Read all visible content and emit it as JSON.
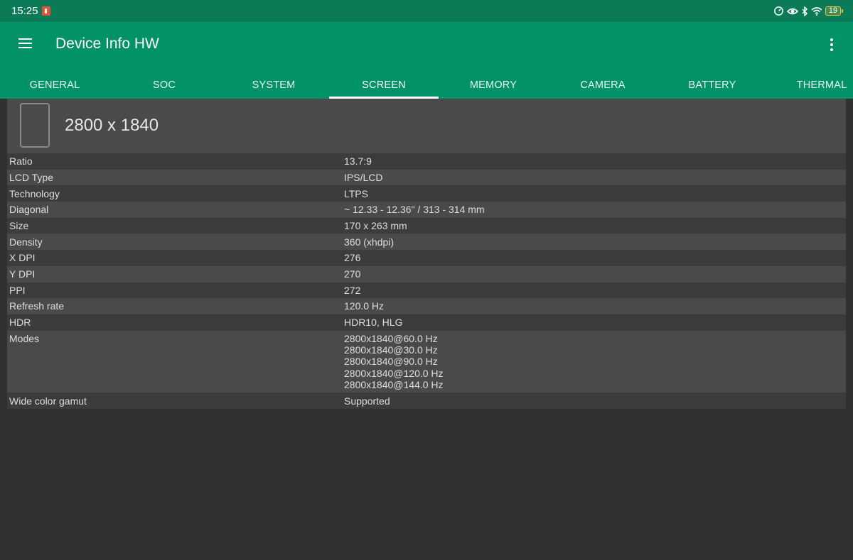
{
  "status_bar": {
    "time": "15:25",
    "battery_level": "19",
    "icons": [
      "speedometer-icon",
      "eye-icon",
      "bluetooth-icon",
      "wifi-icon",
      "battery-icon"
    ],
    "colors": {
      "background": "#0b7a56",
      "recording_badge": "#e8523a",
      "battery": "#f5c542"
    }
  },
  "app_bar": {
    "title": "Device Info HW",
    "menu_icon": "hamburger-menu-icon",
    "overflow_icon": "more-vert-icon",
    "color": "#019267"
  },
  "tabs": [
    {
      "label": "GENERAL",
      "active": false
    },
    {
      "label": "SOC",
      "active": false
    },
    {
      "label": "SYSTEM",
      "active": false
    },
    {
      "label": "SCREEN",
      "active": true
    },
    {
      "label": "MEMORY",
      "active": false
    },
    {
      "label": "CAMERA",
      "active": false
    },
    {
      "label": "BATTERY",
      "active": false
    },
    {
      "label": "THERMAL",
      "active": false
    }
  ],
  "screen": {
    "resolution": "2800 x 1840",
    "device_icon": "tablet-outline-icon",
    "rows": [
      {
        "key": "Ratio",
        "values": [
          "13.7:9"
        ]
      },
      {
        "key": "LCD Type",
        "values": [
          "IPS/LCD"
        ]
      },
      {
        "key": "Technology",
        "values": [
          "LTPS"
        ]
      },
      {
        "key": "Diagonal",
        "values": [
          "~ 12.33 - 12.36\" / 313 - 314 mm"
        ]
      },
      {
        "key": "Size",
        "values": [
          "170 x 263 mm"
        ]
      },
      {
        "key": "Density",
        "values": [
          "360 (xhdpi)"
        ]
      },
      {
        "key": "X DPI",
        "values": [
          "276"
        ]
      },
      {
        "key": "Y DPI",
        "values": [
          "270"
        ]
      },
      {
        "key": "PPI",
        "values": [
          "272"
        ]
      },
      {
        "key": "Refresh rate",
        "values": [
          "120.0 Hz"
        ]
      },
      {
        "key": "HDR",
        "values": [
          "HDR10, HLG"
        ]
      },
      {
        "key": "Modes",
        "values": [
          "2800x1840@60.0 Hz",
          "2800x1840@30.0 Hz",
          "2800x1840@90.0 Hz",
          "2800x1840@120.0 Hz",
          "2800x1840@144.0 Hz"
        ]
      },
      {
        "key": "Wide color gamut",
        "values": [
          "Supported"
        ]
      }
    ]
  }
}
